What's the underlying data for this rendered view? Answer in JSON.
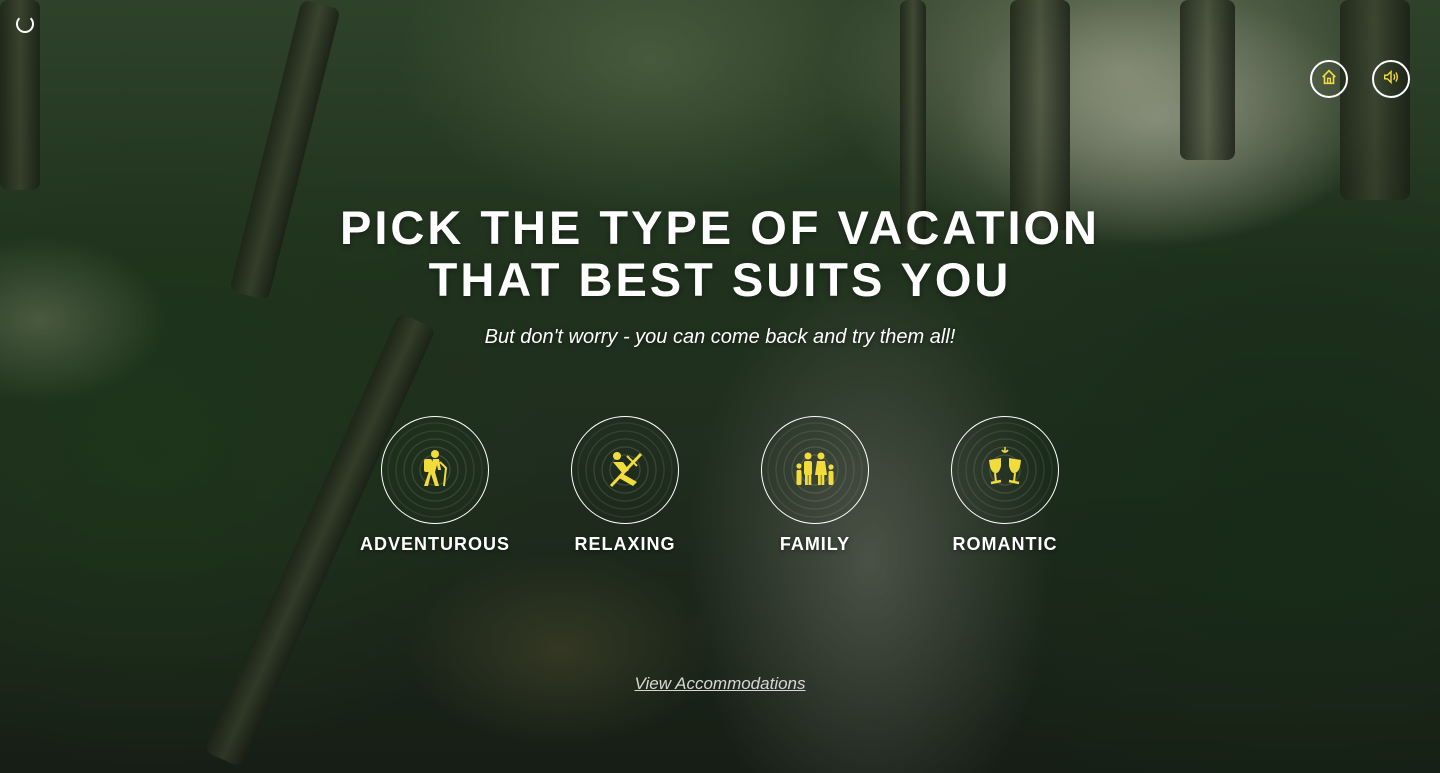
{
  "page": {
    "headline_line1": "PICK THE TYPE OF VACATION",
    "headline_line2": "THAT BEST SUITS YOU",
    "subheadline": "But don't worry - you can come back and try them all!",
    "view_link": "View Accommodations"
  },
  "top_controls": {
    "loader_icon": "loading-ring-icon",
    "home_icon": "home-icon",
    "sound_icon": "speaker-icon"
  },
  "options": [
    {
      "label": "ADVENTUROUS",
      "icon": "hiker-icon"
    },
    {
      "label": "RELAXING",
      "icon": "sunbather-icon"
    },
    {
      "label": "FAMILY",
      "icon": "family-icon"
    },
    {
      "label": "ROMANTIC",
      "icon": "wine-glasses-icon"
    }
  ],
  "colors": {
    "accent_icon": "#f2dc3c",
    "text": "#ffffff",
    "link": "#d7d7d2"
  }
}
